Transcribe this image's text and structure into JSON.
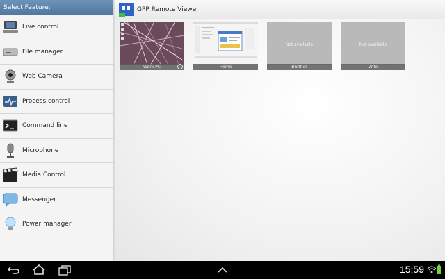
{
  "sidebar": {
    "header": "Select Feature:",
    "items": [
      {
        "label": "Live control",
        "icon": "monitor-icon"
      },
      {
        "label": "File manager",
        "icon": "drive-icon"
      },
      {
        "label": "Web Camera",
        "icon": "webcam-icon"
      },
      {
        "label": "Process control",
        "icon": "pulse-monitor-icon"
      },
      {
        "label": "Command line",
        "icon": "terminal-icon"
      },
      {
        "label": "Microphone",
        "icon": "microphone-icon"
      },
      {
        "label": "Media Control",
        "icon": "clapperboard-icon"
      },
      {
        "label": "Messenger",
        "icon": "chat-bubble-icon"
      },
      {
        "label": "Power manager",
        "icon": "lightbulb-icon"
      }
    ]
  },
  "app": {
    "title": "GPP Remote Viewer"
  },
  "computers": [
    {
      "name": "Work PC",
      "status": ""
    },
    {
      "name": "Home",
      "status": ""
    },
    {
      "name": "Brother",
      "status": "Not available"
    },
    {
      "name": "Wife",
      "status": "Not available"
    }
  ],
  "navbar": {
    "clock": "15:59"
  },
  "colors": {
    "sidebar_header": "#4e77a0",
    "navbar": "#000000",
    "battery": "#6fd13c"
  }
}
